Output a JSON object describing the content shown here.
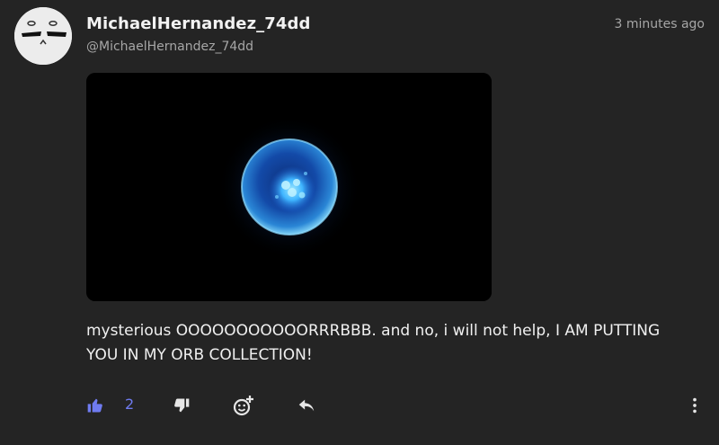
{
  "post": {
    "username": "MichaelHernandez_74dd",
    "handle": "@MichaelHernandez_74dd",
    "timestamp": "3 minutes ago",
    "message": "mysterious OOOOOOOOOOORRRBBB. and no, i will not help, I AM PUTTING YOU IN MY ORB COLLECTION!",
    "media_alt": "glowing blue orb"
  },
  "actions": {
    "like_count": "2",
    "like_icon": "thumbs-up-icon",
    "dislike_icon": "thumbs-down-icon",
    "react_icon": "add-reaction-icon",
    "reply_icon": "reply-icon",
    "more_icon": "more-vertical-icon"
  },
  "colors": {
    "background": "#242424",
    "accent": "#6f7bf0",
    "icon": "#e6e6e6",
    "muted_text": "#a6a6a6"
  }
}
